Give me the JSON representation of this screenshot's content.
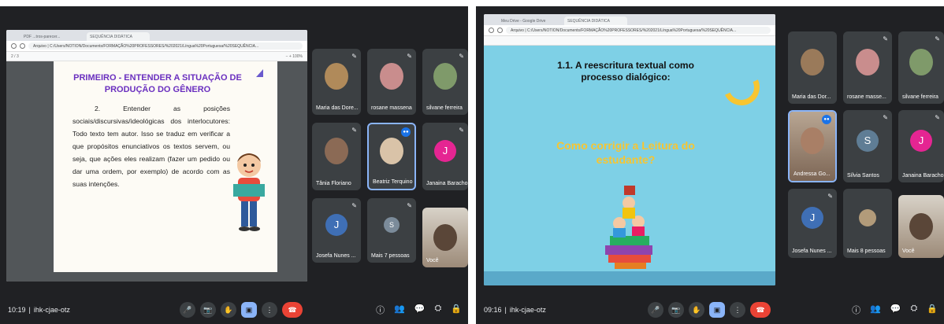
{
  "left": {
    "tabs": [
      "PDF ...tros-parecer...",
      "SEQUÊNCIA DIDÁTICA"
    ],
    "url": "Arquivo | C:/Users/NOTION/Documents/FORMAÇÃO%20PROFESSORES/%202021/Língua%20Portuguesa/%20SEQUÊNCIA...",
    "pdf_page": "2 / 3",
    "pdf_zoom": "−  +  100%",
    "doc": {
      "title": "PRIMEIRO - ENTENDER A SITUAÇÃO DE PRODUÇÃO DO GÊNERO",
      "number": "2.",
      "body": "Entender as posições sociais/discursivas/ideológicas dos interlocutores: Todo texto tem autor. Isso se traduz em verificar a que propósitos enunciativos os textos servem, ou seja, que ações eles realizam (fazer um pedido ou dar uma ordem, por exemplo) de acordo com as suas intenções."
    },
    "tiles": [
      {
        "name": "Maria das Dore...",
        "kind": "photo",
        "color": "#b08a5a"
      },
      {
        "name": "rosane massena",
        "kind": "photo",
        "color": "#c98d8d"
      },
      {
        "name": "silvane ferreira",
        "kind": "photo",
        "color": "#7f9a6a"
      },
      {
        "name": "Tânia Floriano",
        "kind": "photo",
        "color": "#8b6a55"
      },
      {
        "name": "Beatriz Terquino",
        "kind": "photo",
        "color": "#d9c3a8"
      },
      {
        "name": "Janaina Baracho",
        "kind": "letter",
        "letter": "J",
        "color": "#e52592"
      },
      {
        "name": "Josefa Nunes ...",
        "kind": "letter",
        "letter": "J",
        "color": "#3f6fb5"
      },
      {
        "name": "Mais 7 pessoas",
        "kind": "group",
        "letter": "S",
        "color": "#7b8b9a"
      },
      {
        "name": "Você",
        "kind": "video",
        "color": "#8d7563"
      }
    ],
    "meeting": {
      "time": "10:19",
      "code": "ihk-cjae-otz"
    }
  },
  "right": {
    "tabs": [
      "Meu Drive - Google Drive",
      "SEQUÊNCIA DIDÁTICA"
    ],
    "url": "Arquivo | C:/Users/NOTION/Documents/FORMAÇÃO%20PROFESSORES/%202021/Língua%20Portuguesa/%20SEQUÊNCIA...",
    "slide": {
      "title": "1.1. A reescritura textual como processo dialógico:",
      "question": "Como corrigir a Leitura do estudante?"
    },
    "tiles": [
      {
        "name": "Maria das Dor...",
        "kind": "photo",
        "color": "#9a7a5a"
      },
      {
        "name": "rosane masse...",
        "kind": "photo",
        "color": "#c98d8d"
      },
      {
        "name": "silvane ferreira",
        "kind": "photo",
        "color": "#7f9a6a"
      },
      {
        "name": "Andressa Go...",
        "kind": "video",
        "color": "#a97f66"
      },
      {
        "name": "Sílvia Santos",
        "kind": "letter",
        "letter": "S",
        "color": "#5f7d95"
      },
      {
        "name": "Janaina Baracho",
        "kind": "letter",
        "letter": "J",
        "color": "#e52592"
      },
      {
        "name": "Josefa Nunes ...",
        "kind": "letter",
        "letter": "J",
        "color": "#3f6fb5"
      },
      {
        "name": "Mais 8 pessoas",
        "kind": "group",
        "letter": "",
        "color": "#b29b7a"
      },
      {
        "name": "Você",
        "kind": "video",
        "color": "#8d7563"
      }
    ],
    "meeting": {
      "time": "09:16",
      "code": "ihk-cjae-otz"
    }
  },
  "icons": {
    "mic": "🎤",
    "cam": "📷",
    "hand": "✋",
    "present": "▣",
    "more": "⋮",
    "hangup": "☎",
    "info": "ⓘ",
    "people": "👥",
    "chat": "💬",
    "activities": "⛭",
    "lock": "🔒"
  }
}
